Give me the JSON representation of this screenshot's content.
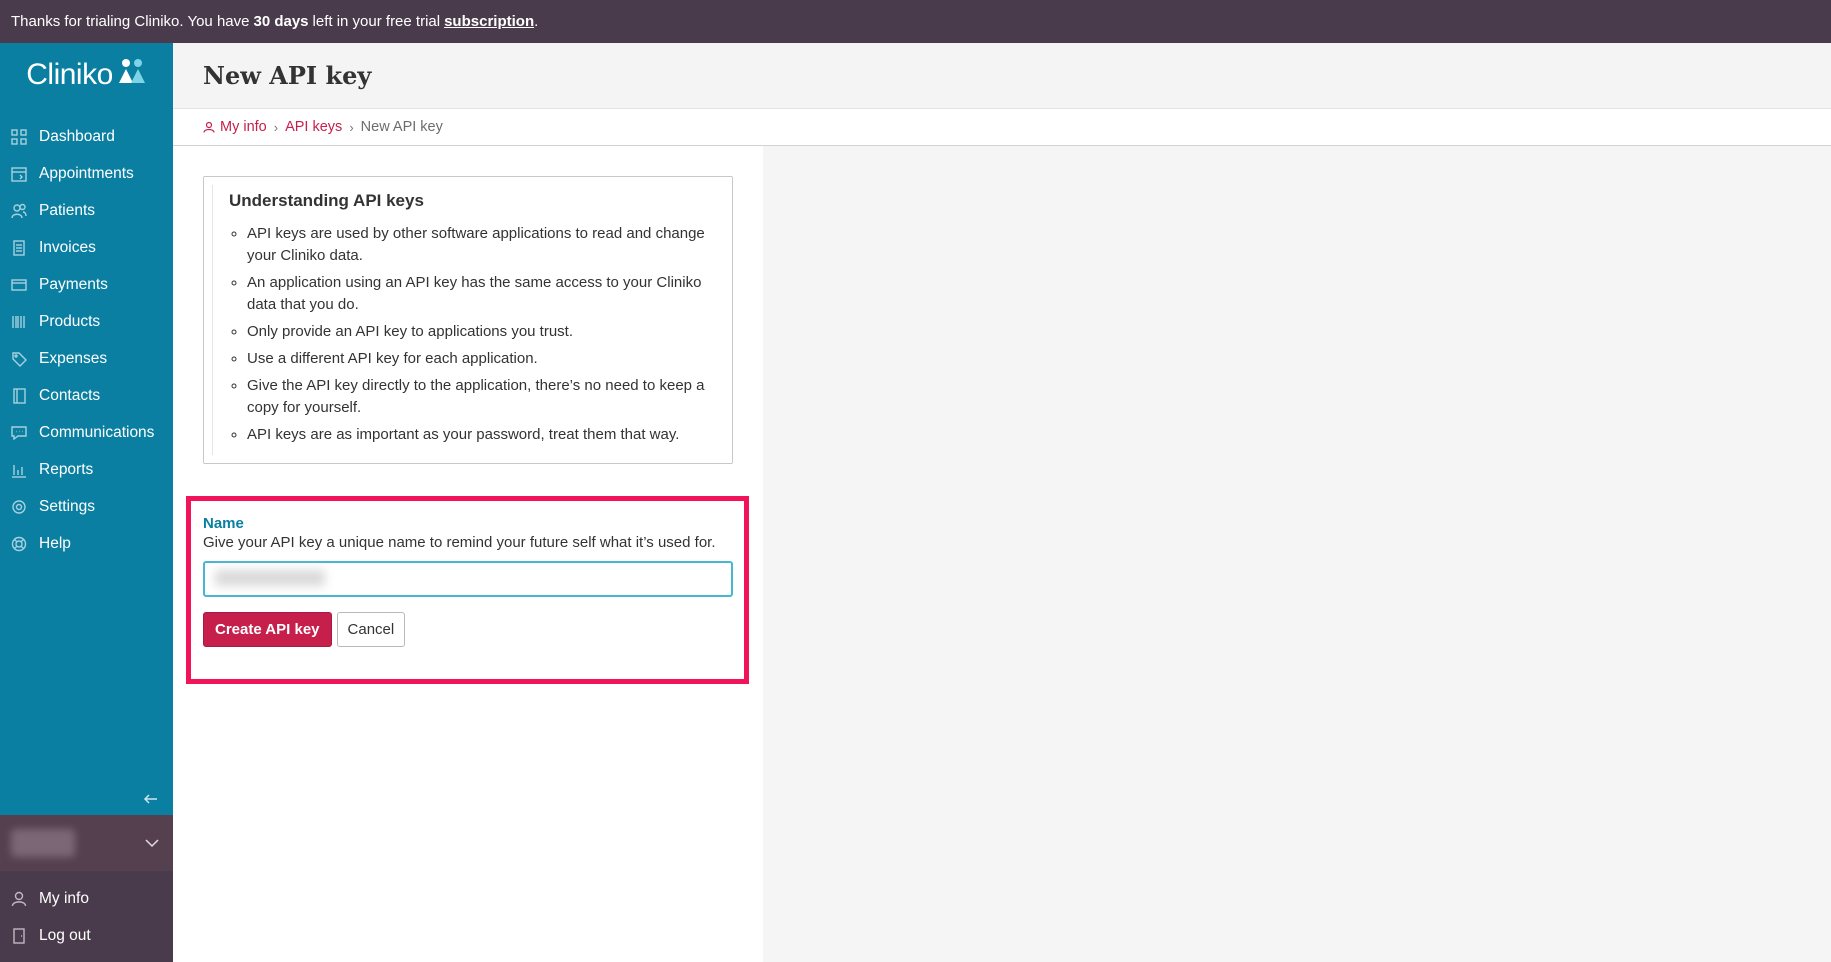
{
  "trial_bar": {
    "prefix": "Thanks for trialing Cliniko. You have",
    "days": "30 days",
    "middle": "left in your free trial",
    "link": "subscription",
    "suffix": "."
  },
  "sidebar": {
    "logo_text": "Cliniko",
    "items": [
      {
        "label": "Dashboard",
        "icon": "grid-icon"
      },
      {
        "label": "Appointments",
        "icon": "calendar-icon"
      },
      {
        "label": "Patients",
        "icon": "people-icon"
      },
      {
        "label": "Invoices",
        "icon": "document-icon"
      },
      {
        "label": "Payments",
        "icon": "card-icon"
      },
      {
        "label": "Products",
        "icon": "barcode-icon"
      },
      {
        "label": "Expenses",
        "icon": "tag-icon"
      },
      {
        "label": "Contacts",
        "icon": "book-icon"
      },
      {
        "label": "Communications",
        "icon": "chat-icon"
      },
      {
        "label": "Reports",
        "icon": "bar-chart-icon"
      },
      {
        "label": "Settings",
        "icon": "gear-icon"
      },
      {
        "label": "Help",
        "icon": "lifebuoy-icon"
      }
    ],
    "bottom_items": [
      {
        "label": "My info",
        "icon": "user-icon"
      },
      {
        "label": "Log out",
        "icon": "door-icon"
      }
    ]
  },
  "header": {
    "title": "New API key"
  },
  "breadcrumb": {
    "items": [
      "My info",
      "API keys"
    ],
    "current": "New API key"
  },
  "info": {
    "title": "Understanding API keys",
    "bullets": [
      "API keys are used by other software applications to read and change your Cliniko data.",
      "An application using an API key has the same access to your Cliniko data that you do.",
      "Only provide an API key to applications you trust.",
      "Use a different API key for each application.",
      "Give the API key directly to the application, there’s no need to keep a copy for yourself.",
      "API keys are as important as your password, treat them that way."
    ]
  },
  "form": {
    "name_label": "Name",
    "name_help": "Give your API key a unique name to remind your future self what it’s used for.",
    "name_value": "",
    "create_label": "Create API key",
    "cancel_label": "Cancel"
  },
  "colors": {
    "sidebar": "#0a7fa1",
    "trial_bar": "#4a3b4c",
    "primary": "#c71f4b",
    "highlight": "#f2145a"
  }
}
